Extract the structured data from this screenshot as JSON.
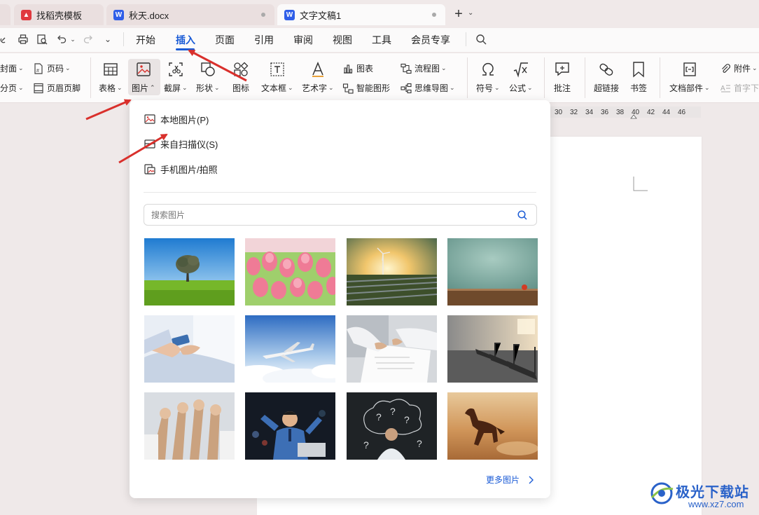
{
  "tabs": [
    {
      "label": "找稻壳模板",
      "icon": "docer-icon",
      "state": "inactive"
    },
    {
      "label": "秋天.docx",
      "icon": "word-doc-icon",
      "state": "inactive"
    },
    {
      "label": "文字文稿1",
      "icon": "word-doc-icon",
      "state": "active"
    }
  ],
  "menu": {
    "items": [
      "开始",
      "插入",
      "页面",
      "引用",
      "审阅",
      "视图",
      "工具",
      "会员专享"
    ],
    "active": "插入"
  },
  "ribbon": {
    "cover_label": "封面",
    "page_number_label": "页码",
    "page_break_label": "分页",
    "header_footer_label": "页眉页脚",
    "table_label": "表格",
    "picture_label": "图片",
    "screenshot_label": "截屏",
    "shape_label": "形状",
    "icon_label": "图标",
    "textbox_label": "文本框",
    "wordart_label": "艺术字",
    "chart_label": "图表",
    "smart_art_label": "智能图形",
    "flowchart_label": "流程图",
    "mindmap_label": "思维导图",
    "symbol_label": "符号",
    "formula_label": "公式",
    "comment_label": "批注",
    "hyperlink_label": "超链接",
    "bookmark_label": "书签",
    "doc_parts_label": "文档部件",
    "attachment_label": "附件",
    "drop_cap_label": "首字下"
  },
  "ruler": {
    "marks": [
      "30",
      "32",
      "34",
      "36",
      "38",
      "40",
      "42",
      "44",
      "46"
    ]
  },
  "dropdown": {
    "options": [
      {
        "label": "本地图片(P)",
        "icon": "local-image-icon"
      },
      {
        "label": "来自扫描仪(S)",
        "icon": "scanner-icon"
      },
      {
        "label": "手机图片/拍照",
        "icon": "phone-image-icon"
      }
    ],
    "search_placeholder": "搜索图片",
    "thumbnails": [
      "tree-field-image",
      "tulips-image",
      "wind-turbine-sunset-image",
      "teal-wall-apple-image",
      "phone-hands-image",
      "airplane-clouds-image",
      "contract-signing-image",
      "gym-treadmill-image",
      "raised-hands-image",
      "celebrating-man-image",
      "question-marks-chalkboard-image",
      "running-horse-image"
    ],
    "more_label": "更多图片"
  },
  "watermark": {
    "text": "极光下载站",
    "url": "www.xz7.com"
  },
  "colors": {
    "accent": "#1a5bd6",
    "arrow": "#d9302c",
    "wps_red": "#e0383e",
    "word_blue": "#2f5ee8"
  }
}
